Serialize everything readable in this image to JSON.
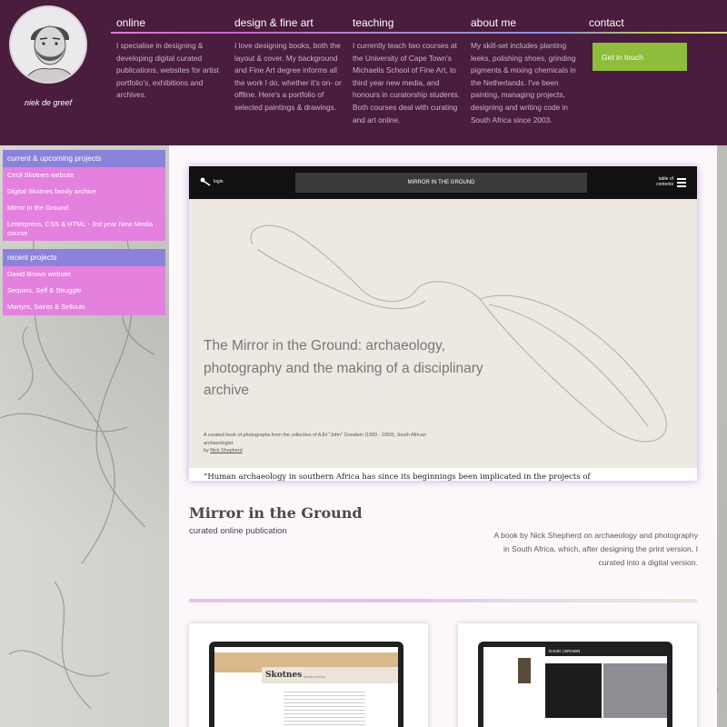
{
  "header": {
    "name": "niek de greef",
    "nav": [
      {
        "title": "online",
        "desc": "I specialise in designing & developing digital curated publications, websites for artist portfolio's, exhibitions and archives."
      },
      {
        "title": "design & fine art",
        "desc": "I love designing books, both the layout & cover. My background and Fine Art degree informs all the work I do, whether it's on- or offline. Here's a portfolio of selected paintings & drawings."
      },
      {
        "title": "teaching",
        "desc": "I currently teach two courses at the University of Cape Town's Michaelis School of Fine Art, to third year new media, and honours in curatorship students. Both courses deal with curating and art online."
      },
      {
        "title": "about me",
        "desc": "My skill-set includes planting leeks, polishing shoes, grinding pigments & mixing chemicals in the Netherlands. I've been painting, managing projects, designing and writing code in South Africa since 2003."
      },
      {
        "title": "contact",
        "desc": ""
      }
    ],
    "cta_label": "Get in touch"
  },
  "sidebar": {
    "current_heading": "current & upcoming projects",
    "current_items": [
      "Cecil Skotnes website",
      "Digital Skotnes family archive",
      "Mirror in the Ground",
      "Letterpress, CSS & HTML - 3rd year New Media course"
    ],
    "recent_heading": "recent projects",
    "recent_items": [
      "David Brown website",
      "Sequins, Self & Struggle",
      "Martyrs, Saints & Sellouts"
    ]
  },
  "screenshot": {
    "login": "login",
    "site_title": "MIRROR IN THE GROUND",
    "toc": "table of contents",
    "heading": "The Mirror in the Ground: archaeology, photography and the making of a disciplinary archive",
    "caption": "A curated book of photographs from the collection of AJH \"John\" Goodwin (1900 - 1959), South African archaeologist.",
    "caption_by_prefix": "by ",
    "caption_by": "Nick Shepherd",
    "quote": "“Human archaeology in southern Africa has since its beginnings been implicated in the projects of"
  },
  "project": {
    "title": "Mirror in the Ground",
    "subtitle": "curated online publication",
    "description": "A book by Nick Shepherd on archaeology and photography in South Africa, which, after designing the print version, I curated into a digital version."
  },
  "cards": [
    {
      "logo": "Skotnes",
      "small": "family archive"
    },
    {
      "brand": "DAVID | BROWN"
    }
  ],
  "colors": {
    "header_bg": "#4a1c3d",
    "cta_bg": "#8dbd3a",
    "sidebar_heading": "#8b83d9",
    "sidebar_item": "#e480dd",
    "main_bg": "#fcf7fb"
  }
}
